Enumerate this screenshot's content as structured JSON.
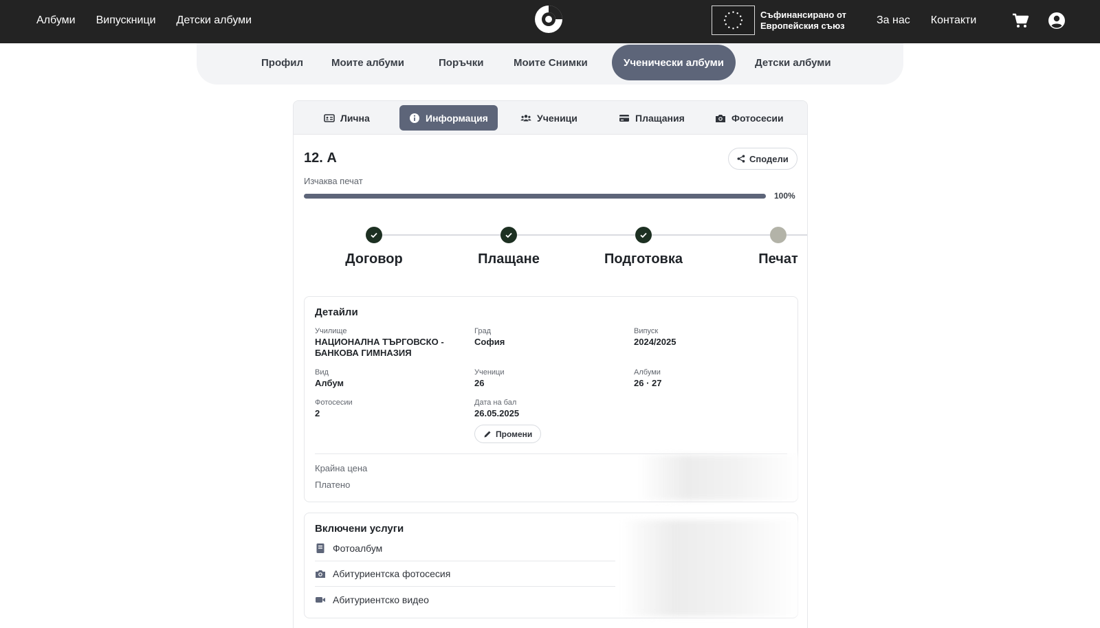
{
  "topbar": {
    "links": [
      "Албуми",
      "Випускници",
      "Детски албуми"
    ],
    "eu_text_line1": "Съфинансирано от",
    "eu_text_line2": "Европейския съюз",
    "right_links": [
      "За нас",
      "Контакти"
    ]
  },
  "mainnav": {
    "tabs": [
      "Профил",
      "Моите албуми",
      "Поръчки",
      "Моите Снимки",
      "Ученически албуми",
      "Детски албуми"
    ],
    "active": "Ученически албуми"
  },
  "subtabs": {
    "items": [
      "Лична",
      "Информация",
      "Ученици",
      "Плащания",
      "Фотосесии"
    ],
    "active": "Информация"
  },
  "group": {
    "name": "12. А",
    "share_label": "Сподели",
    "status": "Изчаква печат",
    "progress_percent": 100,
    "progress_label": "100%"
  },
  "steps": [
    {
      "label": "Договор",
      "done": true
    },
    {
      "label": "Плащане",
      "done": true
    },
    {
      "label": "Подготовка",
      "done": true
    },
    {
      "label": "Печат",
      "done": false
    }
  ],
  "details": {
    "title": "Детайли",
    "school_label": "Училище",
    "school_value_line1": "НАЦИОНАЛНА ТЪРГОВСКО -",
    "school_value_line2": "БАНКОВА ГИМНАЗИЯ",
    "city_label": "Град",
    "city_value": "София",
    "class_label": "Випуск",
    "class_value": "2024/2025",
    "type_label": "Вид",
    "type_value": "Албум",
    "students_label": "Ученици",
    "students_value": "26",
    "albums_label": "Албуми",
    "albums_value": "26 · 27",
    "sessions_label": "Фотосесии",
    "sessions_value": "2",
    "prom_label": "Дата на бал",
    "prom_value": "26.05.2025",
    "edit_label": "Промени",
    "final_price_label": "Крайна цена",
    "paid_label": "Платено"
  },
  "services": {
    "title": "Включени услуги",
    "items": [
      {
        "label": "Фотоалбум",
        "icon": "book-icon"
      },
      {
        "label": "Абитуриентска фотосесия",
        "icon": "camera-icon"
      },
      {
        "label": "Абитуриентско видео",
        "icon": "video-icon"
      }
    ]
  },
  "colors": {
    "topbar": "#232323",
    "accent": "#5d6579",
    "done_step": "#1d3022",
    "pending_step": "#b3b3a8"
  }
}
